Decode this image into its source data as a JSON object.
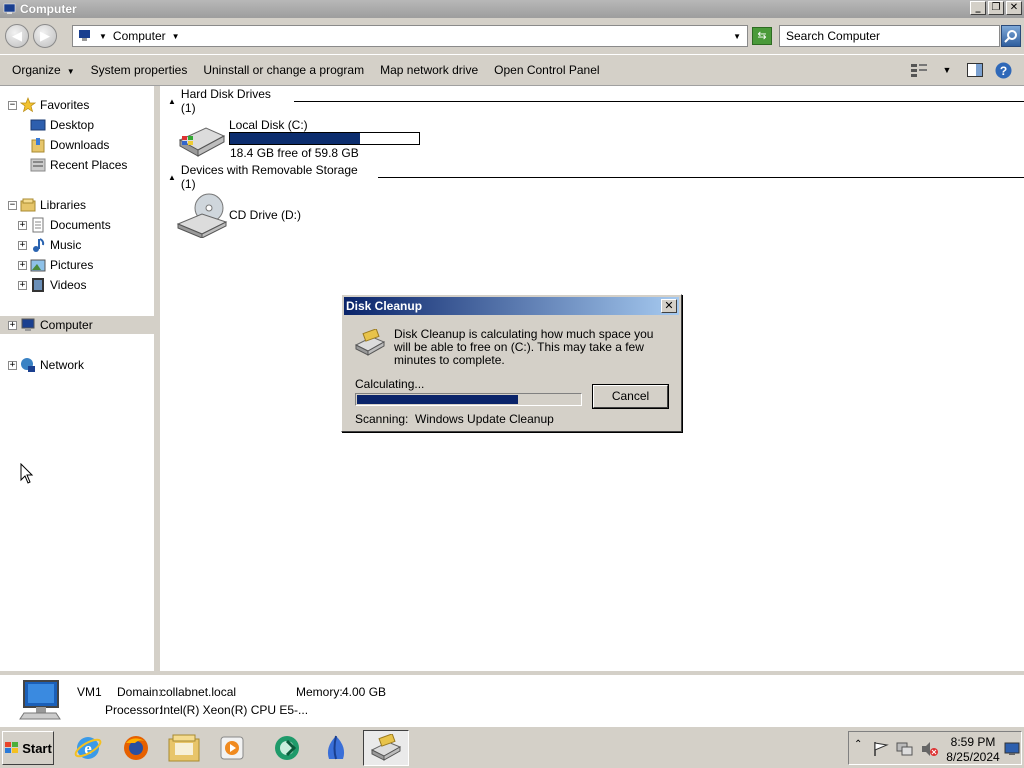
{
  "window": {
    "title": "Computer"
  },
  "address": {
    "crumb": "Computer",
    "search_placeholder": "Search Computer"
  },
  "commands": {
    "organize": "Organize",
    "system_properties": "System properties",
    "uninstall": "Uninstall or change a program",
    "map_drive": "Map network drive",
    "control_panel": "Open Control Panel"
  },
  "nav": {
    "favorites": "Favorites",
    "desktop": "Desktop",
    "downloads": "Downloads",
    "recent": "Recent Places",
    "libraries": "Libraries",
    "documents": "Documents",
    "music": "Music",
    "pictures": "Pictures",
    "videos": "Videos",
    "computer": "Computer",
    "network": "Network"
  },
  "groups": {
    "hdd": "Hard Disk Drives (1)",
    "removable": "Devices with Removable Storage (1)"
  },
  "drives": {
    "c": {
      "name": "Local Disk (C:)",
      "free_text": "18.4 GB free of 59.8 GB",
      "used_fraction": 0.69
    },
    "d": {
      "name": "CD Drive (D:)"
    }
  },
  "dialog": {
    "title": "Disk Cleanup",
    "message": "Disk Cleanup is calculating how much space you will be able to free on  (C:). This may take a few minutes to complete.",
    "status": "Calculating...",
    "progress_fraction": 0.72,
    "cancel": "Cancel",
    "scanning_label": "Scanning:",
    "scanning_item": "Windows Update Cleanup"
  },
  "details": {
    "name": "VM1",
    "domain_label": "Domain:",
    "domain": "collabnet.local",
    "memory_label": "Memory:",
    "memory": "4.00 GB",
    "processor_label": "Processor:",
    "processor": "Intel(R) Xeon(R) CPU E5-..."
  },
  "taskbar": {
    "start": "Start",
    "time": "8:59 PM",
    "date": "8/25/2024"
  }
}
